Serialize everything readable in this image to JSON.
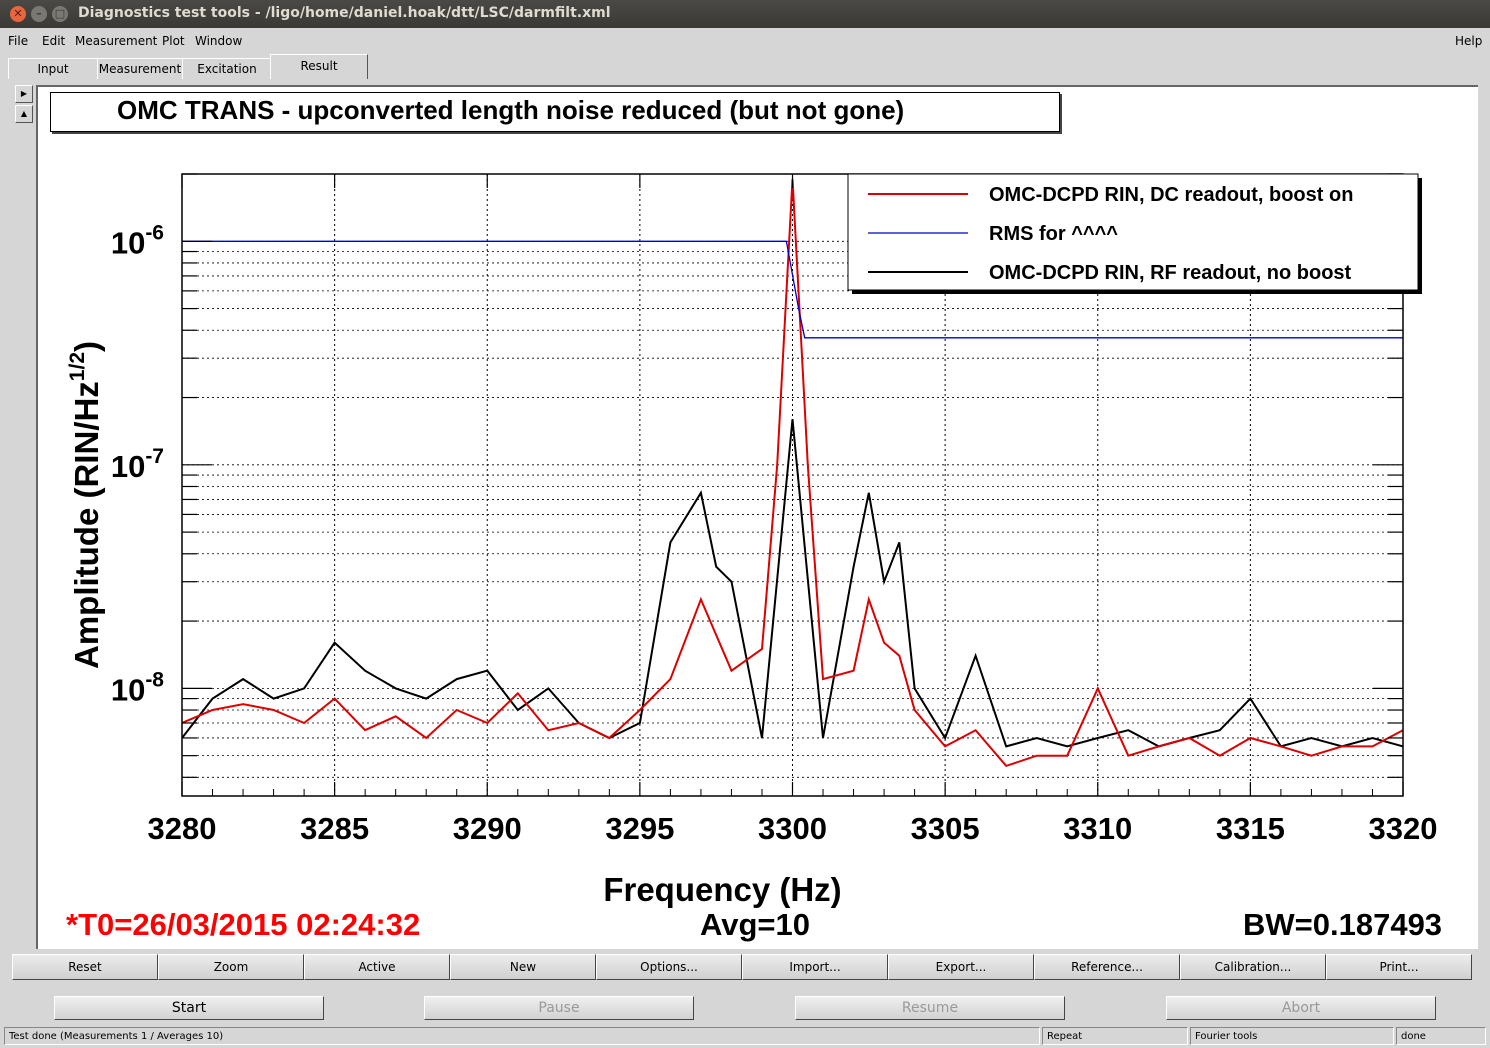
{
  "window": {
    "title": "Diagnostics test tools - /ligo/home/daniel.hoak/dtt/LSC/darmfilt.xml",
    "controls": [
      "close-icon",
      "minimize-icon",
      "maximize-icon"
    ]
  },
  "menubar": {
    "items": [
      "File",
      "Edit",
      "Measurement",
      "Plot",
      "Window"
    ],
    "help": "Help"
  },
  "tabs": [
    "Input",
    "Measurement",
    "Excitation",
    "Result"
  ],
  "active_tab": "Result",
  "plot": {
    "title": "OMC TRANS - upconverted length noise reduced (but not gone)",
    "t0": "*T0=26/03/2015 02:24:32",
    "avg": "Avg=10",
    "bw": "BW=0.187493"
  },
  "chart_data": {
    "type": "line",
    "title": "OMC TRANS - upconverted length noise reduced (but not gone)",
    "xlabel": "Frequency (Hz)",
    "ylabel": "Amplitude (RIN/Hz^(1/2))",
    "ylabel_parts": {
      "main": "Amplitude (RIN/Hz",
      "sup": "1/2",
      "end": ")"
    },
    "xlim": [
      3280,
      3320
    ],
    "ylim": [
      3.3e-09,
      2e-06
    ],
    "yscale": "log",
    "grid": true,
    "legend_position": "top-right",
    "x_ticks": [
      "3280",
      "3285",
      "3290",
      "3295",
      "3300",
      "3305",
      "3310",
      "3315",
      "3320"
    ],
    "y_ticks": [
      {
        "base": "10",
        "exp": "-6",
        "value": 1e-06
      },
      {
        "base": "10",
        "exp": "-7",
        "value": 1e-07
      },
      {
        "base": "10",
        "exp": "-8",
        "value": 1e-08
      }
    ],
    "series": [
      {
        "name": "OMC-DCPD RIN, DC readout, boost on",
        "color": "#dd0000",
        "x": [
          3280,
          3281,
          3282,
          3283,
          3284,
          3285,
          3286,
          3287,
          3288,
          3289,
          3290,
          3291,
          3292,
          3293,
          3294,
          3295,
          3296,
          3297,
          3298,
          3299,
          3299.5,
          3300,
          3300.5,
          3301,
          3302,
          3302.5,
          3303,
          3303.5,
          3304,
          3305,
          3306,
          3307,
          3308,
          3309,
          3310,
          3311,
          3312,
          3313,
          3314,
          3315,
          3316,
          3317,
          3318,
          3319,
          3320
        ],
        "y": [
          7e-09,
          8e-09,
          8.5e-09,
          8e-09,
          7e-09,
          9e-09,
          6.5e-09,
          7.5e-09,
          6e-09,
          8e-09,
          7e-09,
          9.5e-09,
          6.5e-09,
          7e-09,
          6e-09,
          8e-09,
          1.1e-08,
          2.5e-08,
          1.2e-08,
          1.5e-08,
          1e-07,
          1.9e-06,
          1e-07,
          1.1e-08,
          1.2e-08,
          2.5e-08,
          1.6e-08,
          1.4e-08,
          8e-09,
          5.5e-09,
          6.5e-09,
          4.5e-09,
          5e-09,
          5e-09,
          1e-08,
          5e-09,
          5.5e-09,
          6e-09,
          5e-09,
          6e-09,
          5.5e-09,
          5e-09,
          5.5e-09,
          5.5e-09,
          6.5e-09
        ]
      },
      {
        "name": "RMS for ^^^^",
        "color": "#0000cc",
        "x": [
          3280,
          3299.8,
          3300.2,
          3300.4,
          3320
        ],
        "y": [
          1e-06,
          1e-06,
          5e-07,
          3.7e-07,
          3.7e-07
        ]
      },
      {
        "name": "OMC-DCPD RIN, RF readout, no boost",
        "color": "#000000",
        "x": [
          3280,
          3281,
          3282,
          3283,
          3284,
          3285,
          3286,
          3287,
          3288,
          3289,
          3290,
          3291,
          3292,
          3293,
          3294,
          3295,
          3296,
          3297,
          3297.5,
          3298,
          3299,
          3300,
          3301,
          3302,
          3302.5,
          3303,
          3303.5,
          3304,
          3305,
          3306,
          3307,
          3308,
          3309,
          3310,
          3311,
          3312,
          3313,
          3314,
          3315,
          3316,
          3317,
          3318,
          3319,
          3320
        ],
        "y": [
          6e-09,
          9e-09,
          1.1e-08,
          9e-09,
          1e-08,
          1.6e-08,
          1.2e-08,
          1e-08,
          9e-09,
          1.1e-08,
          1.2e-08,
          8e-09,
          1e-08,
          7e-09,
          6e-09,
          7e-09,
          4.5e-08,
          7.5e-08,
          3.5e-08,
          3e-08,
          6e-09,
          1.6e-07,
          6e-09,
          3.5e-08,
          7.5e-08,
          3e-08,
          4.5e-08,
          1e-08,
          6e-09,
          1.4e-08,
          5.5e-09,
          6e-09,
          5.5e-09,
          6e-09,
          6.5e-09,
          5.5e-09,
          6e-09,
          6.5e-09,
          9e-09,
          5.5e-09,
          6e-09,
          5.5e-09,
          6e-09,
          5.5e-09
        ]
      }
    ]
  },
  "buttons_row1": [
    "Reset",
    "Zoom",
    "Active",
    "New",
    "Options...",
    "Import...",
    "Export...",
    "Reference...",
    "Calibration...",
    "Print..."
  ],
  "buttons_row2": [
    "Start",
    "Pause",
    "Resume",
    "Abort"
  ],
  "statusbar": {
    "message": "Test done (Measurements 1 / Averages 10)",
    "repeat": "Repeat",
    "tools": "Fourier tools",
    "state": "done"
  }
}
